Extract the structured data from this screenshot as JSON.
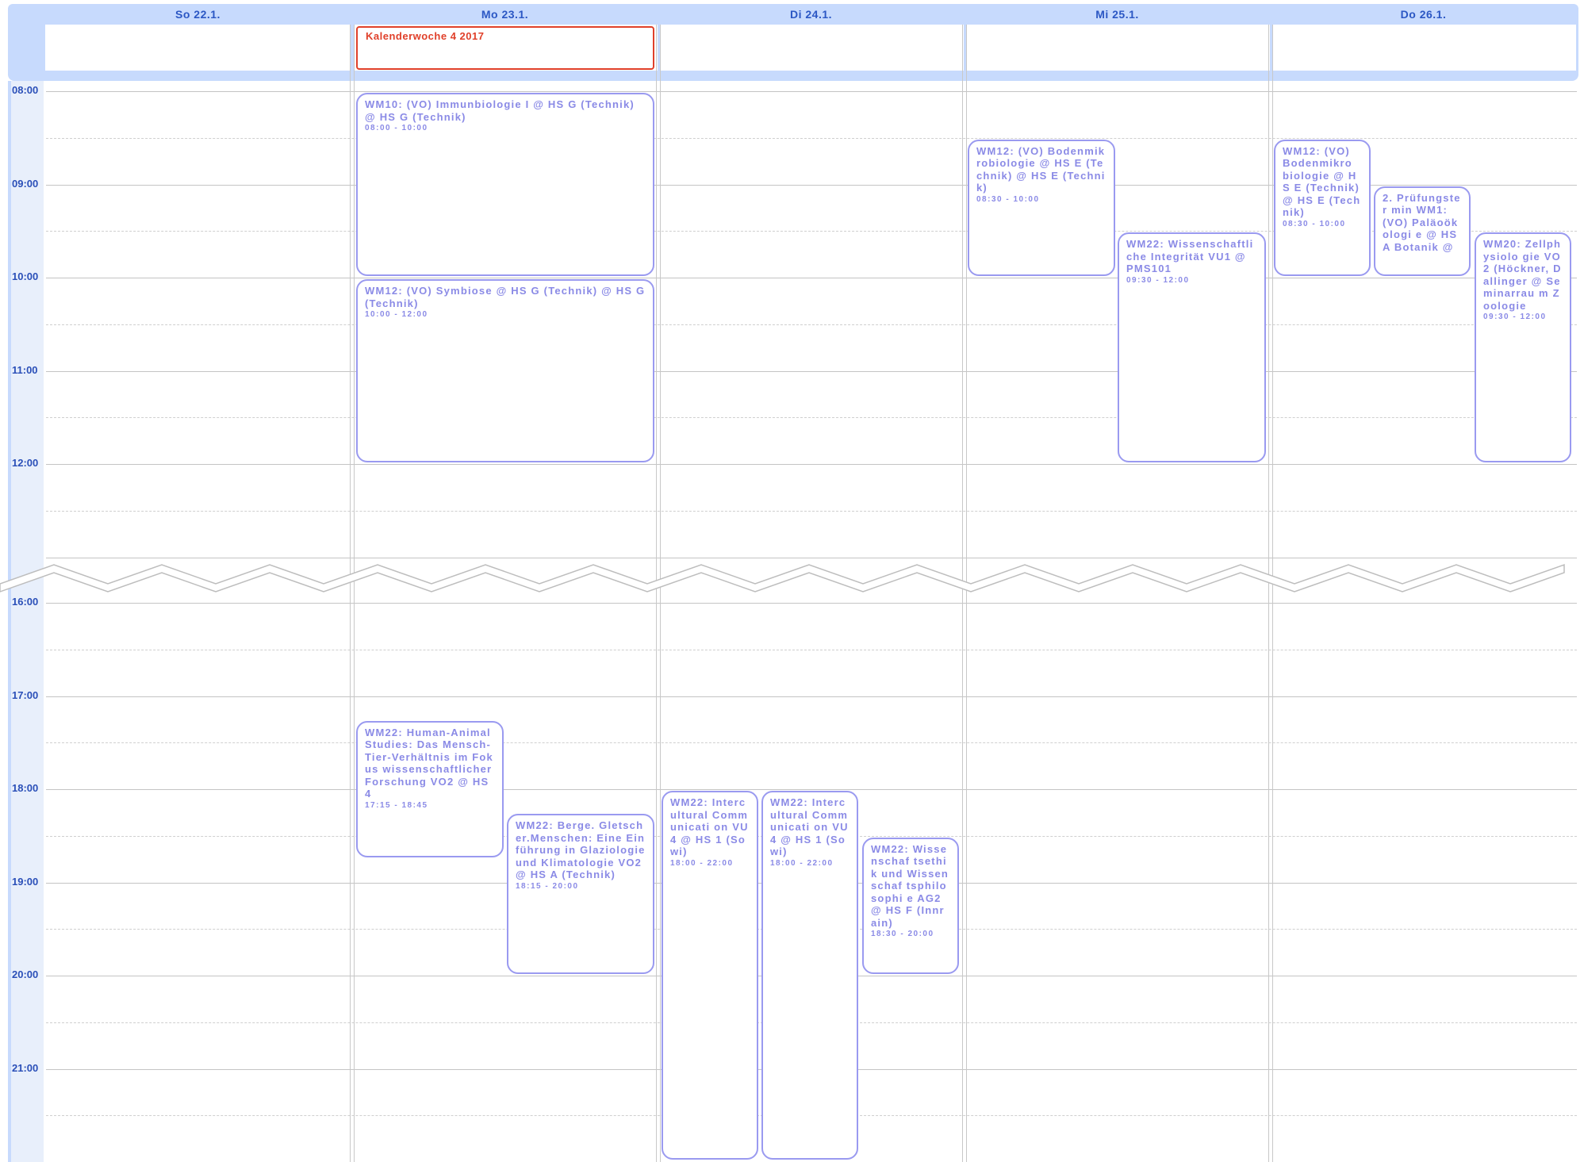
{
  "days": [
    {
      "label": "So 22.1."
    },
    {
      "label": "Mo 23.1."
    },
    {
      "label": "Di 24.1."
    },
    {
      "label": "Mi 25.1."
    },
    {
      "label": "Do 26.1."
    }
  ],
  "all_day_event": {
    "title": "Kalenderwoche 4 2017",
    "color": "#e0402a"
  },
  "hours_top": [
    "08:00",
    "09:00",
    "10:00",
    "11:00",
    "12:00"
  ],
  "hours_bottom": [
    "16:00",
    "17:00",
    "18:00",
    "19:00",
    "20:00",
    "21:00"
  ],
  "colors": {
    "event_border": "#9a9af0",
    "event_text": "#8a8ae6",
    "header": "#c7dafd",
    "day_text": "#2b57c4"
  },
  "events": [
    {
      "day": 1,
      "title": "WM10: (VO) Immunbiologie I @ HS G (Technik) @ HS G (Technik)",
      "time": "08:00 - 10:00"
    },
    {
      "day": 1,
      "title": "WM12: (VO) Symbiose @ HS G (Technik) @ HS G (Technik)",
      "time": "10:00 - 12:00"
    },
    {
      "day": 3,
      "title": "WM12: (VO) Bodenmikrobiologie @ HS E (Technik) @ HS E (Technik)",
      "time": "08:30 - 10:00"
    },
    {
      "day": 3,
      "title": "WM22: Wissenschaftliche Integrität VU1 @ PMS101",
      "time": "09:30 - 12:00"
    },
    {
      "day": 4,
      "title": "WM12: (VO) Bodenmikro biologie @ HS E (Technik) @ HS E (Technik)",
      "time": "08:30 - 10:00"
    },
    {
      "day": 4,
      "title": "2. Prüfungster min WM1: (VO) Paläoökologi e @ HS A Botanik @",
      "time": ""
    },
    {
      "day": 4,
      "title": "WM20: Zellphysiolo gie VO2 (Höckner, Dallinger @ Seminarrau m Zoologie",
      "time": "09:30 - 12:00"
    },
    {
      "day": 1,
      "title": "WM22: Human-Animal Studies: Das Mensch-Tier-Verhältnis im Fokus wissenschaftlicher Forschung VO2 @ HS 4",
      "time": "17:15 - 18:45"
    },
    {
      "day": 1,
      "title": "WM22: Berge. Gletscher.Menschen: Eine Einführung in Glaziologie und Klimatologie VO2 @ HS A (Technik)",
      "time": "18:15 - 20:00"
    },
    {
      "day": 2,
      "title": "WM22: Intercultural Communicati on VU4 @ HS 1 (Sowi)",
      "time": "18:00 - 22:00"
    },
    {
      "day": 2,
      "title": "WM22: Intercultural Communicati on VU4 @ HS 1 (Sowi)",
      "time": "18:00 - 22:00"
    },
    {
      "day": 2,
      "title": "WM22: Wissenschaf tsethik und Wissenschaf tsphilosophi e AG2 @ HS F (Innrain)",
      "time": "18:30 - 20:00"
    }
  ]
}
